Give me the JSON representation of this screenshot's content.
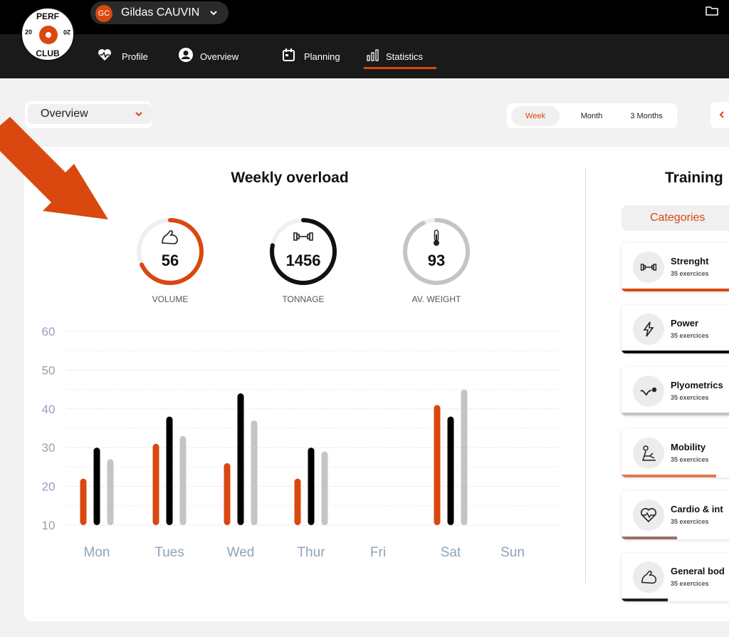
{
  "header": {
    "logo": {
      "top": "PERF",
      "bottom": "CLUB",
      "left_num": "20",
      "right_num": "20"
    },
    "user": {
      "initials": "GC",
      "name": "Gildas CAUVIN"
    },
    "nav": [
      {
        "label": "Profile",
        "icon": "heart-pulse-icon"
      },
      {
        "label": "Overview",
        "icon": "user-circle-icon"
      },
      {
        "label": "Planning",
        "icon": "calendar-icon"
      },
      {
        "label": "Statistics",
        "icon": "bar-chart-icon",
        "active": true
      }
    ]
  },
  "controls": {
    "view_select": "Overview",
    "period_tabs": [
      {
        "label": "Week",
        "active": true
      },
      {
        "label": "Month"
      },
      {
        "label": "3 Months"
      }
    ]
  },
  "weekly": {
    "title": "Weekly overload",
    "gauges": [
      {
        "value": "56",
        "label": "VOLUME",
        "fill": 0.68,
        "color": "#d9480f"
      },
      {
        "value": "1456",
        "label": "TONNAGE",
        "fill": 0.78,
        "color": "#111111"
      },
      {
        "value": "93",
        "label": "AV. WEIGHT",
        "fill": 0.93,
        "color": "#c4c4c4"
      }
    ]
  },
  "chart_data": {
    "type": "bar",
    "categories": [
      "Mon",
      "Tues",
      "Wed",
      "Thur",
      "Fri",
      "Sat",
      "Sun"
    ],
    "series": [
      {
        "values": [
          22,
          31,
          26,
          22,
          null,
          41,
          null
        ],
        "color": "#d9480f"
      },
      {
        "values": [
          30,
          38,
          44,
          30,
          null,
          38,
          null
        ],
        "color": "#000000"
      },
      {
        "values": [
          27,
          33,
          37,
          29,
          null,
          45,
          null
        ],
        "color": "#c4c4c4"
      }
    ],
    "yticks": [
      "60",
      "50",
      "40",
      "30",
      "20",
      "10"
    ],
    "ylim": [
      10,
      60
    ],
    "grid": true
  },
  "training": {
    "title": "Training",
    "categories_label": "Categories",
    "items": [
      {
        "name": "Strenght",
        "sub": "35 exercices",
        "icon": "dumbbell-icon",
        "progress": 1.0,
        "color": "#d9480f"
      },
      {
        "name": "Power",
        "sub": "35 exercices",
        "icon": "lightning-icon",
        "progress": 1.0,
        "color": "#000000"
      },
      {
        "name": "Plyometrics",
        "sub": "35 exercices",
        "icon": "bounce-icon",
        "progress": 1.0,
        "color": "#c4c4c4"
      },
      {
        "name": "Mobility",
        "sub": "35 exercices",
        "icon": "stretch-icon",
        "progress": 0.78,
        "color": "#e07a4f"
      },
      {
        "name": "Cardio & int",
        "sub": "35 exercices",
        "icon": "heart-pulse-icon",
        "progress": 0.46,
        "color": "#9b6e67"
      },
      {
        "name": "General bod",
        "sub": "35 exercices",
        "icon": "arm-icon",
        "progress": 0.38,
        "color": "#222222"
      }
    ]
  }
}
